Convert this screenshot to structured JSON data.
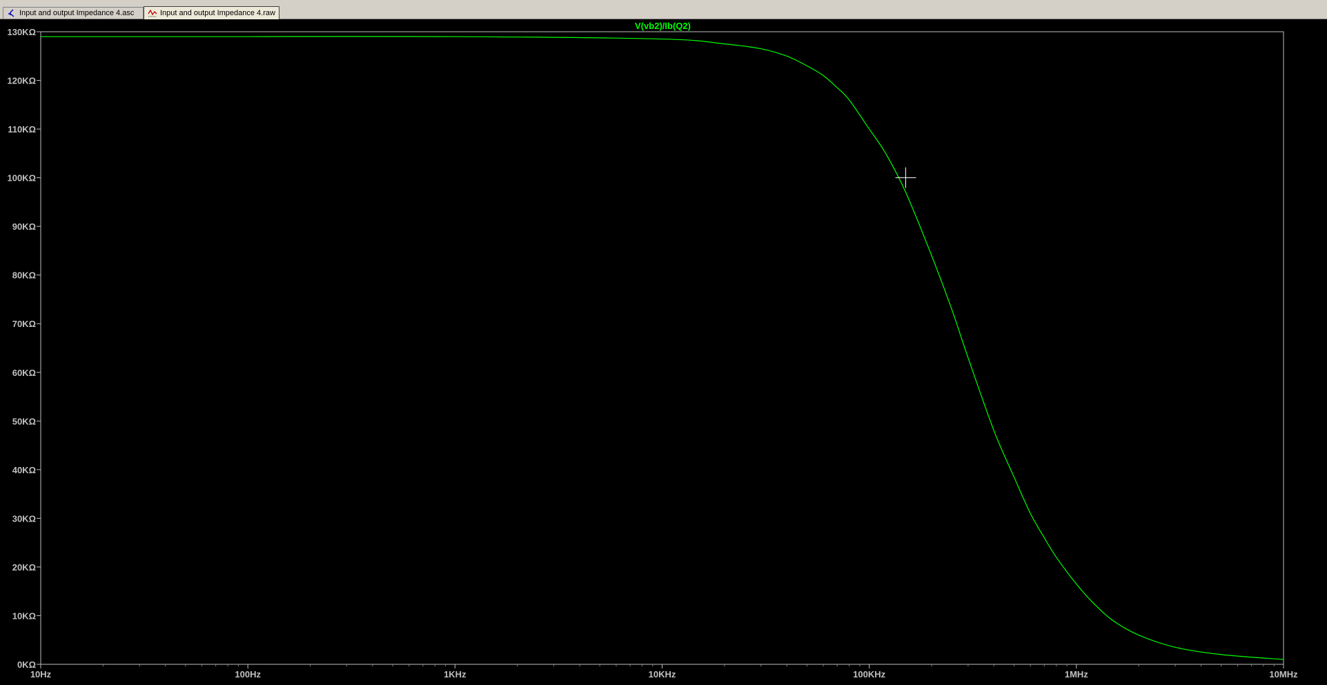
{
  "tabs": [
    {
      "label": "Input and output Impedance 4.asc",
      "icon": "schematic-icon",
      "active": false
    },
    {
      "label": "Input and output Impedance 4.raw",
      "icon": "waveform-icon",
      "active": true
    }
  ],
  "colors": {
    "background": "#000000",
    "trace": "#00ff00",
    "axis": "#c0c0c0",
    "ticks": "#808080",
    "cursor": "#ffffff"
  },
  "chart_data": {
    "type": "line",
    "title": "V(vb2)/Ib(Q2)",
    "xscale": "log",
    "xlim": [
      10,
      10000000
    ],
    "ylim": [
      0,
      130000
    ],
    "x_ticks": [
      {
        "value": 10,
        "label": "10Hz"
      },
      {
        "value": 100,
        "label": "100Hz"
      },
      {
        "value": 1000,
        "label": "1KHz"
      },
      {
        "value": 10000,
        "label": "10KHz"
      },
      {
        "value": 100000,
        "label": "100KHz"
      },
      {
        "value": 1000000,
        "label": "1MHz"
      },
      {
        "value": 10000000,
        "label": "10MHz"
      }
    ],
    "y_ticks": [
      {
        "value": 0,
        "label": "0KΩ"
      },
      {
        "value": 10000,
        "label": "10KΩ"
      },
      {
        "value": 20000,
        "label": "20KΩ"
      },
      {
        "value": 30000,
        "label": "30KΩ"
      },
      {
        "value": 40000,
        "label": "40KΩ"
      },
      {
        "value": 50000,
        "label": "50KΩ"
      },
      {
        "value": 60000,
        "label": "60KΩ"
      },
      {
        "value": 70000,
        "label": "70KΩ"
      },
      {
        "value": 80000,
        "label": "80KΩ"
      },
      {
        "value": 90000,
        "label": "90KΩ"
      },
      {
        "value": 100000,
        "label": "100KΩ"
      },
      {
        "value": 110000,
        "label": "110KΩ"
      },
      {
        "value": 120000,
        "label": "120KΩ"
      },
      {
        "value": 130000,
        "label": "130KΩ"
      }
    ],
    "series": [
      {
        "name": "V(vb2)/Ib(Q2)",
        "x": [
          10,
          100,
          1000,
          10000,
          20000,
          30000,
          40000,
          50000,
          60000,
          70000,
          80000,
          100000,
          120000,
          150000,
          200000,
          250000,
          300000,
          400000,
          500000,
          600000,
          700000,
          800000,
          1000000,
          1200000,
          1500000,
          2000000,
          3000000,
          5000000,
          10000000
        ],
        "y": [
          129000,
          129000,
          129000,
          128500,
          127500,
          126500,
          125000,
          123000,
          121000,
          118500,
          116000,
          110000,
          105000,
          97000,
          84000,
          73000,
          63000,
          48000,
          38500,
          31000,
          26000,
          22000,
          16500,
          12700,
          9000,
          6000,
          3500,
          2000,
          1000
        ]
      }
    ],
    "cursor": {
      "x": 150000,
      "y": 100000
    }
  }
}
